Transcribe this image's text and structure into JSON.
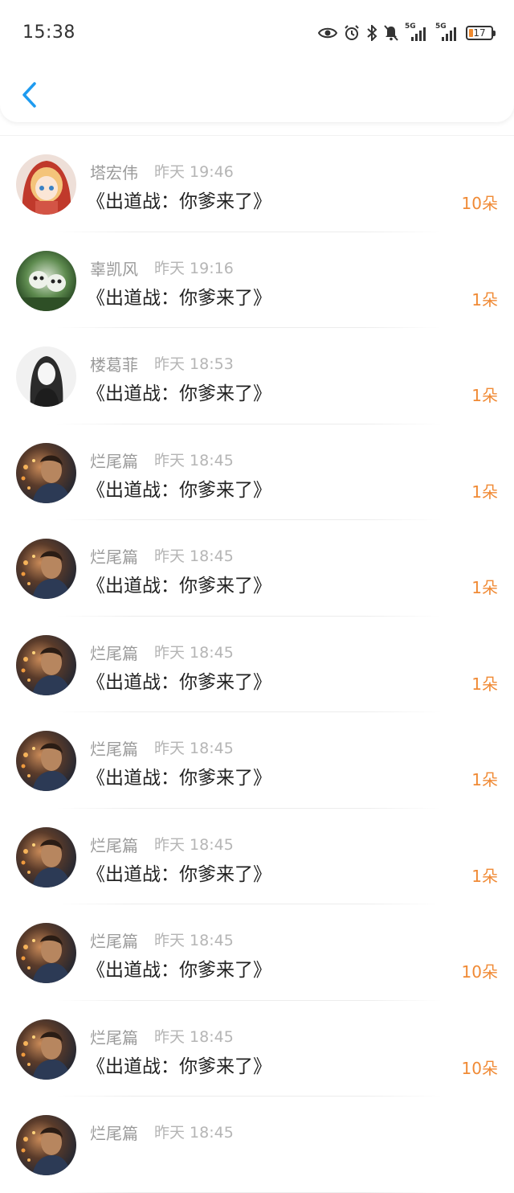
{
  "status_bar": {
    "time": "15:38",
    "network_label": "5G",
    "battery": "17",
    "icons": [
      "eye-icon",
      "alarm-icon",
      "bluetooth-icon",
      "mute-icon",
      "signal-icon",
      "signal-icon",
      "battery-icon"
    ]
  },
  "header": {
    "back_icon": "chevron-left-icon",
    "accent": "#1e9bf0"
  },
  "colors": {
    "count": "#f08a35",
    "name": "#9a9a9a",
    "time": "#b5b5b5",
    "title": "#222222"
  },
  "rows": [
    {
      "name": "塔宏伟",
      "time": "昨天 19:46",
      "title": "《出道战：你爹来了》",
      "count": "10朵",
      "avatar": "anime-girl-red-hood-avatar"
    },
    {
      "name": "辜凯风",
      "time": "昨天 19:16",
      "title": "《出道战：你爹来了》",
      "count": "1朵",
      "avatar": "green-cartoon-avatar"
    },
    {
      "name": "楼葛菲",
      "time": "昨天 18:53",
      "title": "《出道战：你爹来了》",
      "count": "1朵",
      "avatar": "sketch-girl-avatar"
    },
    {
      "name": "烂尾篇",
      "time": "昨天 18:45",
      "title": "《出道战：你爹来了》",
      "count": "1朵",
      "avatar": "dark-photo-avatar"
    },
    {
      "name": "烂尾篇",
      "time": "昨天 18:45",
      "title": "《出道战：你爹来了》",
      "count": "1朵",
      "avatar": "dark-photo-avatar"
    },
    {
      "name": "烂尾篇",
      "time": "昨天 18:45",
      "title": "《出道战：你爹来了》",
      "count": "1朵",
      "avatar": "dark-photo-avatar"
    },
    {
      "name": "烂尾篇",
      "time": "昨天 18:45",
      "title": "《出道战：你爹来了》",
      "count": "1朵",
      "avatar": "dark-photo-avatar"
    },
    {
      "name": "烂尾篇",
      "time": "昨天 18:45",
      "title": "《出道战：你爹来了》",
      "count": "1朵",
      "avatar": "dark-photo-avatar"
    },
    {
      "name": "烂尾篇",
      "time": "昨天 18:45",
      "title": "《出道战：你爹来了》",
      "count": "10朵",
      "avatar": "dark-photo-avatar"
    },
    {
      "name": "烂尾篇",
      "time": "昨天 18:45",
      "title": "《出道战：你爹来了》",
      "count": "10朵",
      "avatar": "dark-photo-avatar"
    },
    {
      "name": "烂尾篇",
      "time": "昨天 18:45",
      "title": "",
      "count": "",
      "avatar": "dark-photo-avatar"
    }
  ]
}
